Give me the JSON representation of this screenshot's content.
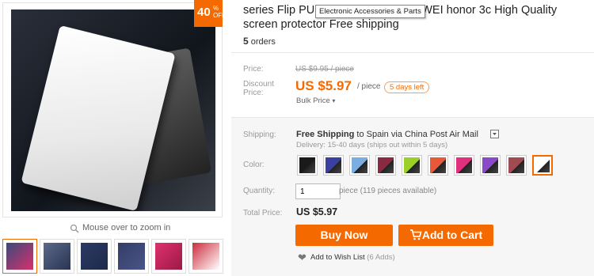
{
  "gallery": {
    "discount_pct": "40",
    "discount_suffix_top": "%",
    "discount_suffix_bottom": "OFF",
    "zoom_hint": "Mouse over to zoom in",
    "thumbnails": [
      {
        "colors": [
          "#3a4a7a",
          "#d8306e"
        ]
      },
      {
        "colors": [
          "#5a6a88",
          "#2a3352"
        ]
      },
      {
        "colors": [
          "#2b3a66",
          "#1f2a48"
        ]
      },
      {
        "colors": [
          "#333d66",
          "#4a5588"
        ]
      },
      {
        "colors": [
          "#e0306e",
          "#9b1a46"
        ]
      },
      {
        "colors": [
          "#cc2c3a",
          "#ffffff"
        ]
      }
    ]
  },
  "product": {
    "title": "series Flip PU Leather Case for HUAWEI honor 3c High Quality screen protector Free shipping",
    "title_first_line_start": "series Flip PU",
    "title_first_line_end": "or HUAWEI honor 3c High Quality",
    "title_second_line": "screen protector Free shipping",
    "tooltip": "Electronic Accessories & Parts",
    "orders_count": "5",
    "orders_label": "orders"
  },
  "price": {
    "price_label": "Price:",
    "original": "US $9.95 / piece",
    "discount_label_1": "Discount",
    "discount_label_2": "Price:",
    "current": "US $5.97",
    "per_piece": "/ piece",
    "days_left": "5 days left",
    "bulk": "Bulk Price"
  },
  "shipping": {
    "label": "Shipping:",
    "free": "Free Shipping",
    "to": "to",
    "destination": "Spain via China Post Air Mail",
    "delivery": "Delivery: 15-40 days (ships out within 5 days)"
  },
  "color": {
    "label": "Color:",
    "swatches": [
      "#1a1a1a",
      "#3a3fa0",
      "#7aaee0",
      "#8a2a40",
      "#9ad028",
      "#e8583a",
      "#e0307e",
      "#8a4ac8",
      "#a04a52",
      "#ffffff"
    ],
    "selected_index": 9
  },
  "quantity": {
    "label": "Quantity:",
    "value": "1",
    "note": "piece (119 pieces available)"
  },
  "total": {
    "label": "Total Price:",
    "value": "US $5.97"
  },
  "actions": {
    "buy_now": "Buy Now",
    "add_to_cart": "Add to Cart",
    "wishlist": "Add to Wish List",
    "wishlist_count": "(6 Adds)"
  },
  "colors": {
    "accent": "#f56a00"
  }
}
